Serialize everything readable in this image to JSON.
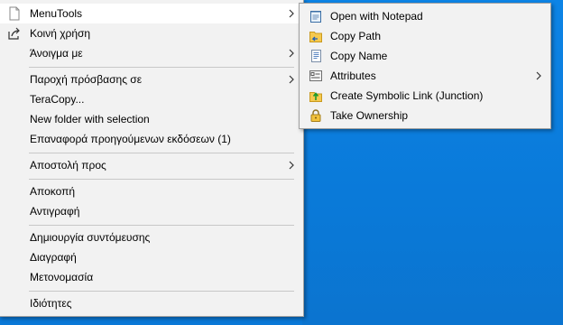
{
  "main_menu": {
    "items": [
      {
        "label": "MenuTools",
        "icon": "file-icon",
        "has_submenu": true,
        "selected": true
      },
      {
        "label": "Κοινή χρήση",
        "icon": "share-icon"
      },
      {
        "label": "Άνοιγμα με",
        "has_submenu": true
      },
      {
        "label": "Παροχή πρόσβασης σε",
        "has_submenu": true
      },
      {
        "label": "TeraCopy..."
      },
      {
        "label": "New folder with selection"
      },
      {
        "label": "Επαναφορά προηγούμενων εκδόσεων (1)"
      },
      {
        "label": "Αποστολή προς",
        "has_submenu": true
      },
      {
        "label": "Αποκοπή"
      },
      {
        "label": "Αντιγραφή"
      },
      {
        "label": "Δημιουργία συντόμευσης"
      },
      {
        "label": "Διαγραφή"
      },
      {
        "label": "Μετονομασία"
      },
      {
        "label": "Ιδιότητες"
      }
    ]
  },
  "sub_menu": {
    "items": [
      {
        "label": "Open with Notepad",
        "icon": "notepad-icon"
      },
      {
        "label": "Copy Path",
        "icon": "copy-path-icon"
      },
      {
        "label": "Copy Name",
        "icon": "copy-name-icon"
      },
      {
        "label": "Attributes",
        "icon": "attributes-icon",
        "has_submenu": true
      },
      {
        "label": "Create Symbolic Link (Junction)",
        "icon": "symlink-icon"
      },
      {
        "label": "Take Ownership",
        "icon": "lock-icon"
      }
    ]
  },
  "colors": {
    "desktop": "#0a78d7",
    "menu_bg": "#f2f2f2",
    "selected_bg": "#ffffff"
  }
}
